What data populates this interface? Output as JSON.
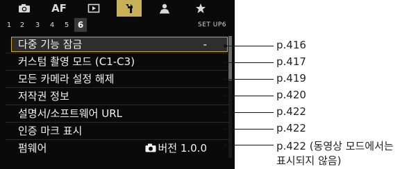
{
  "tabs": {
    "af_label": "AF",
    "items": [
      {
        "icon": "camera-icon"
      },
      {
        "icon": "af-text"
      },
      {
        "icon": "playback-icon"
      },
      {
        "icon": "wrench-icon",
        "active": true
      },
      {
        "icon": "person-cog-icon"
      },
      {
        "icon": "star-icon"
      }
    ]
  },
  "subtabs": {
    "numbers": [
      "1",
      "2",
      "3",
      "4",
      "5",
      "6"
    ],
    "active_index": 5,
    "set_label": "SET UP6"
  },
  "menu": {
    "items": [
      {
        "label": "다중 기능 잠금",
        "value": "-",
        "ref": "p.416"
      },
      {
        "label": "커스텀 촬영 모드 (C1-C3)",
        "value": "",
        "ref": "p.417"
      },
      {
        "label": "모든 카메라 설정 해제",
        "value": "",
        "ref": "p.419"
      },
      {
        "label": "저작권 정보",
        "value": "",
        "ref": "p.420"
      },
      {
        "label": "설명서/소프트웨어 URL",
        "value": "",
        "ref": "p.422"
      },
      {
        "label": "인증 마크 표시",
        "value": "",
        "ref": "p.422"
      },
      {
        "label": "펌웨어",
        "value": "버전 1.0.0",
        "ref": "p.422 (동영상 모드에서는",
        "ref_line2": "표시되지 않음)"
      }
    ],
    "selected_index": 0,
    "scroll_position": 0.0
  },
  "colors": {
    "screen_bg": "#0a0a0a",
    "active_tab": "#c8b05a",
    "selection_border": "#c9a848",
    "text": "#f2f2f2"
  }
}
